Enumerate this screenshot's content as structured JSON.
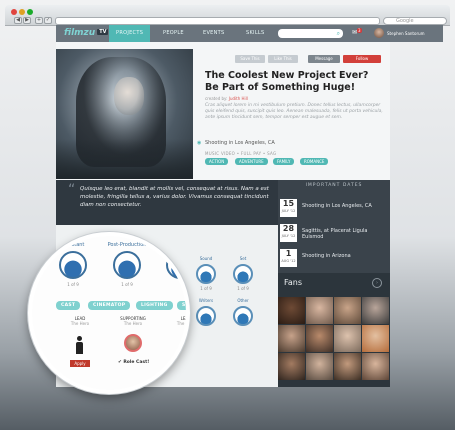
{
  "browser": {
    "search_placeholder": "Google",
    "nav_back": "◀",
    "nav_fwd": "▶",
    "nav_add": "+"
  },
  "app": {
    "logo": "filmzu",
    "logo_badge": "TV",
    "accent": "#50b8b4"
  },
  "nav": {
    "items": [
      "PROJECTS",
      "PEOPLE",
      "EVENTS",
      "SKILLS"
    ],
    "active": "PROJECTS",
    "notifications": "3",
    "user": "Stephen Santorum"
  },
  "project": {
    "actions": {
      "save": "Save This",
      "like": "Like This",
      "message": "Message",
      "follow": "Follow"
    },
    "title": "The Coolest New Project Ever? Be Part of Something Huge!",
    "created_label": "created by:",
    "creator": "Judith Hill",
    "description": "Cras aliquet lorem in mi vestibulum pretium. Donec tellus lectus, ullamcorper quis eleifend quis, suscipit quis leo. Aenean malesuada, felis ut porta vehicula, ante ipsum tincidunt sem, tempor semper est augue et sem.",
    "location": "Shooting in Los Angeles, CA",
    "meta": "MUSIC VIDEO  •  FULL PAY  •  SAG",
    "tags": [
      "ACTION",
      "ADVENTURE",
      "FAMILY",
      "ROMANCE"
    ],
    "quote": "Quisque leo erat, blandit at mollis vel, consequat at risus. Nam a est molestie, fringilla tellus a, varius dolor. Vivamus consequat tincidunt diam non consectetur."
  },
  "important_dates": {
    "heading": "IMPORTANT DATES",
    "items": [
      {
        "day": "15",
        "month": "JULY '12",
        "text": "Shooting in Los Angeles, CA"
      },
      {
        "day": "28",
        "month": "JULY '12",
        "text": "Sagittis, at Placerat Ligula Euismod"
      },
      {
        "day": "1",
        "month": "AUG '12",
        "text": "Shooting in Arizona"
      }
    ]
  },
  "fans": {
    "heading": "Fans",
    "arrow": "›"
  },
  "crew": {
    "roles": [
      {
        "name": "Assistant",
        "count": "1 of 9"
      },
      {
        "name": "Post-Production",
        "count": "1 of 9"
      }
    ],
    "small_roles": [
      {
        "name": "Sound",
        "count": "1 of 9"
      },
      {
        "name": "Set",
        "count": "1 of 9"
      },
      {
        "name": "Writers",
        "count": "1 of 9"
      },
      {
        "name": "Other",
        "count": "1 of 9"
      }
    ],
    "tabs": [
      "CAST",
      "CINEMATOP",
      "LIGHTING",
      "SO"
    ],
    "cast": [
      {
        "type": "LEAD",
        "role": "The Hero",
        "button": "Apply"
      },
      {
        "type": "SUPPORTING",
        "role": "The Hero",
        "status": "✔ Role Cast!"
      },
      {
        "type": "LEAD",
        "role": "The Hero"
      }
    ]
  }
}
